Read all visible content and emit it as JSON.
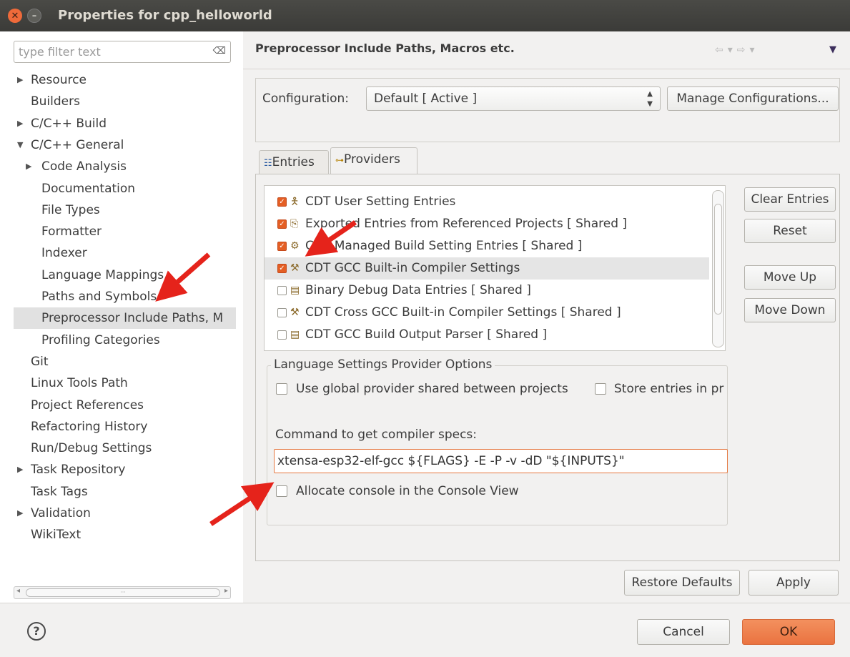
{
  "window": {
    "title": "Properties for cpp_helloworld"
  },
  "filter": {
    "placeholder": "type filter text",
    "clear_icon": "clear-icon"
  },
  "tree": [
    {
      "label": "Resource",
      "expander": "collapsed"
    },
    {
      "label": "Builders",
      "expander": "none"
    },
    {
      "label": "C/C++ Build",
      "expander": "collapsed"
    },
    {
      "label": "C/C++ General",
      "expander": "expanded"
    },
    {
      "label": "Code Analysis",
      "expander": "collapsed"
    },
    {
      "label": "Documentation",
      "expander": "none"
    },
    {
      "label": "File Types",
      "expander": "none"
    },
    {
      "label": "Formatter",
      "expander": "none"
    },
    {
      "label": "Indexer",
      "expander": "none"
    },
    {
      "label": "Language Mappings",
      "expander": "none"
    },
    {
      "label": "Paths and Symbols",
      "expander": "none"
    },
    {
      "label": "Preprocessor Include Paths, M",
      "expander": "none",
      "selected": true
    },
    {
      "label": "Profiling Categories",
      "expander": "none"
    },
    {
      "label": "Git",
      "expander": "none"
    },
    {
      "label": "Linux Tools Path",
      "expander": "none"
    },
    {
      "label": "Project References",
      "expander": "none"
    },
    {
      "label": "Refactoring History",
      "expander": "none"
    },
    {
      "label": "Run/Debug Settings",
      "expander": "none"
    },
    {
      "label": "Task Repository",
      "expander": "collapsed"
    },
    {
      "label": "Task Tags",
      "expander": "none"
    },
    {
      "label": "Validation",
      "expander": "collapsed"
    },
    {
      "label": "WikiText",
      "expander": "none"
    }
  ],
  "page": {
    "title": "Preprocessor Include Paths, Macros etc.",
    "configuration_label": "Configuration:",
    "configuration_value": "Default  [ Active ]",
    "manage_button": "Manage Configurations...",
    "tabs": [
      {
        "label": "Entries",
        "icon": "entries-icon"
      },
      {
        "label": "Providers",
        "icon": "providers-icon",
        "active": true
      }
    ]
  },
  "providers": [
    {
      "label": "CDT User Setting Entries",
      "checked": true,
      "icon": "user-icon"
    },
    {
      "label": "Exported Entries from Referenced Projects  [ Shared ]",
      "checked": true,
      "icon": "export-icon"
    },
    {
      "label": "CDT Managed Build Setting Entries  [ Shared ]",
      "checked": true,
      "icon": "build-icon"
    },
    {
      "label": "CDT GCC Built-in Compiler Settings",
      "checked": true,
      "icon": "compiler-icon",
      "selected": true
    },
    {
      "label": "Binary Debug Data Entries  [ Shared ]",
      "checked": false,
      "icon": "debug-data-icon"
    },
    {
      "label": "CDT Cross GCC Built-in Compiler Settings  [ Shared ]",
      "checked": false,
      "icon": "cross-compiler-icon"
    },
    {
      "label": "CDT GCC Build Output Parser  [ Shared ]",
      "checked": false,
      "icon": "parser-icon"
    }
  ],
  "side_buttons": {
    "clear_entries": "Clear Entries",
    "reset": "Reset",
    "move_up": "Move Up",
    "move_down": "Move Down"
  },
  "options": {
    "group_title": "Language Settings Provider Options",
    "use_global": "Use global provider shared between projects",
    "store_entries": "Store entries in pr",
    "command_label": "Command to get compiler specs:",
    "command_value": "xtensa-esp32-elf-gcc ${FLAGS} -E -P -v -dD \"${INPUTS}\"",
    "allocate_console": "Allocate console in the Console View"
  },
  "footer": {
    "restore_defaults": "Restore Defaults",
    "apply": "Apply",
    "cancel": "Cancel",
    "ok": "OK",
    "help_icon": "help-icon"
  },
  "colors": {
    "accent": "#e45e24",
    "titlebar": "#3b3b38",
    "arrow": "#e5231b"
  }
}
